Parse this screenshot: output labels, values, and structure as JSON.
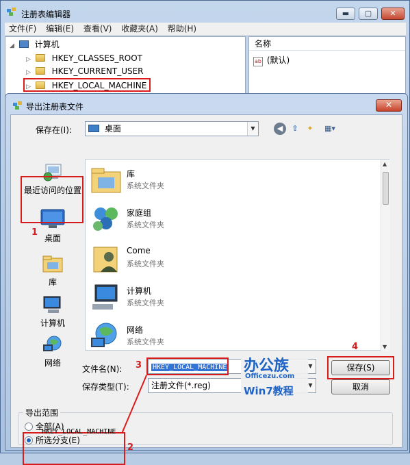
{
  "outer_window": {
    "title": "注册表编辑器",
    "menu": [
      "文件(F)",
      "编辑(E)",
      "查看(V)",
      "收藏夹(A)",
      "帮助(H)"
    ],
    "tree": {
      "root": "计算机",
      "items": [
        "HKEY_CLASSES_ROOT",
        "HKEY_CURRENT_USER",
        "HKEY_LOCAL_MACHINE"
      ]
    },
    "list_header": "名称",
    "list_item": "(默认)",
    "list_item_icon": "ab"
  },
  "dialog": {
    "title": "导出注册表文件",
    "close_glyph": "✕",
    "save_in_label": "保存在(I):",
    "save_in_value": "桌面",
    "places": [
      {
        "label": "最近访问的位置",
        "icon": "recent-icon"
      },
      {
        "label": "桌面",
        "icon": "desktop-icon"
      },
      {
        "label": "库",
        "icon": "library-icon"
      },
      {
        "label": "计算机",
        "icon": "computer-icon"
      },
      {
        "label": "网络",
        "icon": "network-icon"
      }
    ],
    "files": [
      {
        "name": "库",
        "type": "系统文件夹",
        "icon": "library-icon"
      },
      {
        "name": "家庭组",
        "type": "系统文件夹",
        "icon": "homegroup-icon"
      },
      {
        "name": "Come",
        "type": "系统文件夹",
        "icon": "user-folder-icon"
      },
      {
        "name": "计算机",
        "type": "系统文件夹",
        "icon": "computer-icon"
      },
      {
        "name": "网络",
        "type": "系统文件夹",
        "icon": "network-icon"
      }
    ],
    "filename_label": "文件名(N):",
    "filename_value": "HKEY_LOCAL_MACHINE",
    "filetype_label": "保存类型(T):",
    "filetype_value": "注册文件(*.reg)",
    "save_button": "保存(S)",
    "cancel_button": "取消",
    "export_range": {
      "title": "导出范围",
      "option_all": "全部(A)",
      "option_selected": "所选分支(E)",
      "selected_value": "HKEY_LOCAL_MACHINE"
    }
  },
  "annotations": {
    "num1": "1",
    "num2": "2",
    "num3": "3",
    "num4": "4",
    "color": "#d81b1b"
  },
  "watermark": {
    "brand_cn": "办公族",
    "brand_url": "Officezu.com",
    "tagline": "Win7教程"
  }
}
